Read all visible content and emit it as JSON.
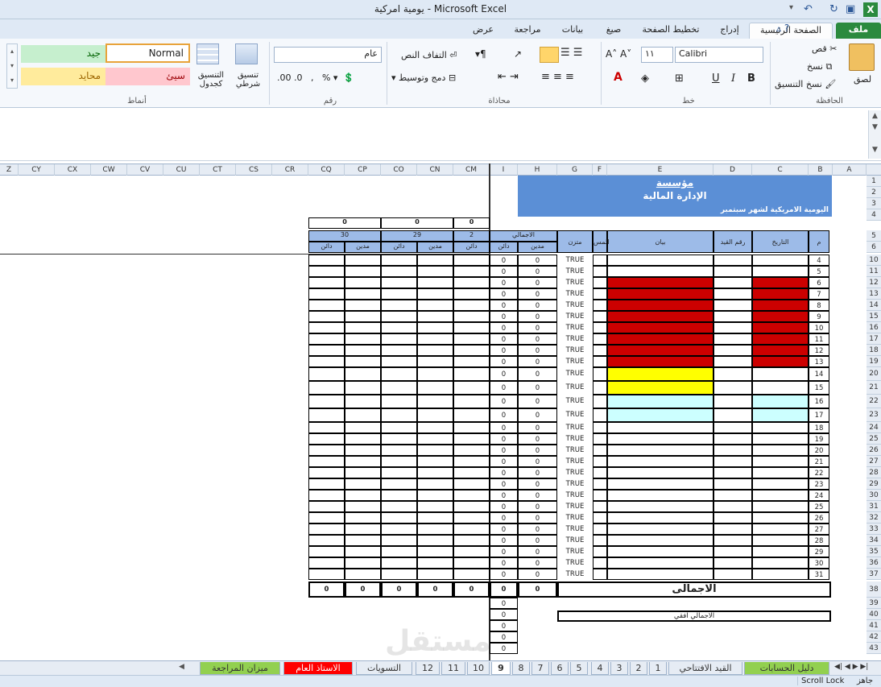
{
  "window": {
    "title": "يومية امركية - Microsoft Excel"
  },
  "ribbon_tabs": [
    "ملف",
    "الصفحة الرئيسية",
    "إدراج",
    "تخطيط الصفحة",
    "صيغ",
    "بيانات",
    "مراجعة",
    "عرض"
  ],
  "clipboard": {
    "paste": "لصق",
    "cut": "قص",
    "copy": "نسخ",
    "format_painter": "نسخ التنسيق",
    "group": "الحافظة"
  },
  "font": {
    "name": "Calibri",
    "size": "١١",
    "group": "خط"
  },
  "alignment": {
    "wrap": "التفاف النص",
    "merge": "دمج وتوسيط",
    "group": "محاذاة"
  },
  "number": {
    "format": "عام",
    "group": "رقم"
  },
  "styles": {
    "conditional": "تنسيق شرطي",
    "as_table": "التنسيق كجدول",
    "normal": "Normal",
    "good": "جيد",
    "bad": "سيئ",
    "neutral": "محايد",
    "group": "أنماط"
  },
  "columns_right": [
    "A",
    "B",
    "C",
    "D",
    "E",
    "F",
    "G",
    "H",
    "I"
  ],
  "columns_left": [
    "CM",
    "CN",
    "CO",
    "CP",
    "CQ",
    "CR",
    "CS",
    "CT",
    "CU",
    "CV",
    "CW",
    "CX",
    "CY",
    "Z"
  ],
  "sheet": {
    "org": "مؤسسة",
    "dept": "الإدارة المالية",
    "subtitle": "اليومية الامريكية لشهر سبتمبر",
    "h_num": "م",
    "h_date": "التاريخ",
    "h_entry": "رقم القيد",
    "h_desc": "بيان",
    "h_f": "المس",
    "h_balanced": "متزن",
    "h_total": "الاجمالي",
    "h_debit": "مدين",
    "h_credit": "دائن",
    "day30": "30",
    "day29": "29",
    "day28": "2",
    "zero": "0",
    "true": "TRUE",
    "total_label": "الاجمالى",
    "horizontal_total": "الاجمالي افقي"
  },
  "rows": [
    {
      "rn": "10",
      "m": "4"
    },
    {
      "rn": "11",
      "m": "5"
    },
    {
      "rn": "12",
      "m": "6"
    },
    {
      "rn": "13",
      "m": "7"
    },
    {
      "rn": "14",
      "m": "8"
    },
    {
      "rn": "15",
      "m": "9"
    },
    {
      "rn": "16",
      "m": "10"
    },
    {
      "rn": "17",
      "m": "11"
    },
    {
      "rn": "18",
      "m": "12"
    },
    {
      "rn": "19",
      "m": "13"
    },
    {
      "rn": "20",
      "m": "14"
    },
    {
      "rn": "21",
      "m": "15"
    },
    {
      "rn": "22",
      "m": "16"
    },
    {
      "rn": "23",
      "m": "17"
    },
    {
      "rn": "24",
      "m": "18"
    },
    {
      "rn": "25",
      "m": "19"
    },
    {
      "rn": "26",
      "m": "20"
    },
    {
      "rn": "27",
      "m": "21"
    },
    {
      "rn": "28",
      "m": "22"
    },
    {
      "rn": "29",
      "m": "23"
    },
    {
      "rn": "30",
      "m": "24"
    },
    {
      "rn": "31",
      "m": "25"
    },
    {
      "rn": "32",
      "m": "26"
    },
    {
      "rn": "33",
      "m": "27"
    },
    {
      "rn": "34",
      "m": "28"
    },
    {
      "rn": "35",
      "m": "29"
    },
    {
      "rn": "36",
      "m": "30"
    },
    {
      "rn": "37",
      "m": "31"
    }
  ],
  "sheet_tabs": [
    "دليل الحسابات",
    "القيد الافتتاحي",
    "1",
    "2",
    "3",
    "4",
    "5",
    "6",
    "7",
    "8",
    "9",
    "10",
    "11",
    "12",
    "التسويات",
    "الاستاذ العام",
    "ميزان المراجعة"
  ],
  "status": {
    "ready": "جاهز",
    "scroll_lock": "Scroll Lock"
  },
  "colors": {
    "header_blue": "#5b8fd6",
    "red": "#cc0000",
    "yellow": "#ffff00",
    "cyan": "#ccffff",
    "tab_green": "#92d050",
    "tab_red": "#ff0000"
  }
}
